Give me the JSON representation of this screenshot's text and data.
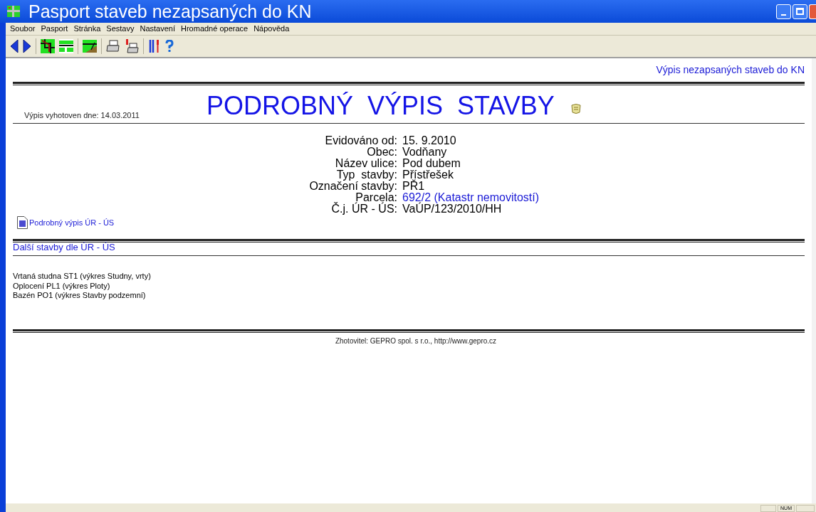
{
  "window": {
    "title": "Pasport staveb nezapsaných do KN"
  },
  "menu": [
    "Soubor",
    "Pasport",
    "Stránka",
    "Sestavy",
    "Nastavení",
    "Hromadné operace",
    "Nápověda"
  ],
  "toolbar": [
    {
      "kind": "back"
    },
    {
      "kind": "forward"
    },
    {
      "kind": "sep"
    },
    {
      "kind": "map"
    },
    {
      "kind": "plan"
    },
    {
      "kind": "sep"
    },
    {
      "kind": "terrain"
    },
    {
      "kind": "sep"
    },
    {
      "kind": "print"
    },
    {
      "kind": "print-setup"
    },
    {
      "kind": "sep"
    },
    {
      "kind": "tools"
    },
    {
      "kind": "help"
    }
  ],
  "page": {
    "header_link": "Výpis nezapsaných staveb do KN",
    "date": "Výpis vyhotoven dne: 14.03.2011",
    "title": "PODROBNÝ  VÝPIS  STAVBY",
    "fields": [
      {
        "label": "Evidováno od:",
        "value": "15. 9.2010",
        "link": false
      },
      {
        "label": "Obec:",
        "value": "Vodňany",
        "link": false
      },
      {
        "label": "Název ulice:",
        "value": "Pod dubem",
        "link": false
      },
      {
        "label": "Typ  stavby:",
        "value": "Přístřešek",
        "link": false
      },
      {
        "label": "Označení stavby:",
        "value": "PŘ1",
        "link": false
      },
      {
        "label": "Parcela:",
        "value": "692/2 (Katastr nemovitostí)",
        "link": true
      },
      {
        "label": "Č.j. ÚR - ÚS:",
        "value": "VaÚP/123/2010/HH",
        "link": false
      }
    ],
    "detail_link": "Podrobný výpis ÚR - ÚS",
    "section_title": "Další stavby dle ÚR - ÚS",
    "other_buildings": [
      "Vrtaná studna ST1 (výkres Studny, vrty)",
      "Oplocení PL1 (výkres Ploty)",
      "Bazén PO1 (výkres Stavby podzemní)"
    ],
    "footer": "Zhotovitel: GEPRO spol. s r.o., http://www.gepro.cz"
  },
  "status_bar": {
    "panel_2": "NUM"
  }
}
